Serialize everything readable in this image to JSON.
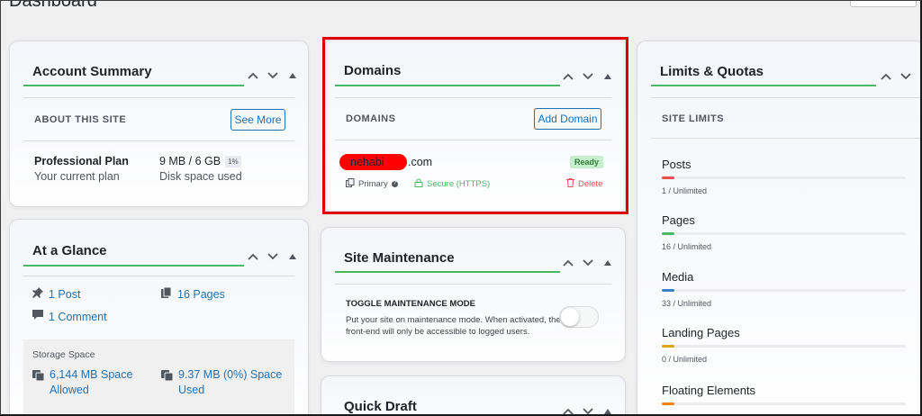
{
  "page": {
    "title": "Dashboard"
  },
  "account_summary": {
    "title": "Account Summary",
    "section": "ABOUT THIS SITE",
    "see_more": "See More",
    "plan_name": "Professional Plan",
    "plan_sub": "Your current plan",
    "disk_value": "9 MB / 6 GB",
    "disk_badge": "1%",
    "disk_sub": "Disk space used"
  },
  "at_a_glance": {
    "title": "At a Glance",
    "posts": "1 Post",
    "pages": "16 Pages",
    "comments": "1 Comment",
    "storage_label": "Storage Space",
    "space_allowed_1": "6,144 MB Space",
    "space_allowed_2": "Allowed",
    "space_used_1": "9.37 MB (0%) Space",
    "space_used_2": "Used"
  },
  "domains": {
    "title": "Domains",
    "section": "DOMAINS",
    "add_button": "Add Domain",
    "domain_prefix": "nehabi",
    "domain_suffix": ".com",
    "status": "Ready",
    "primary": "Primary",
    "secure": "Secure (HTTPS)",
    "delete": "Delete"
  },
  "site_maintenance": {
    "title": "Site Maintenance",
    "section": "TOGGLE MAINTENANCE MODE",
    "description_1": "Put your site on maintenance mode. When activated, the",
    "description_2": "front-end will only be accessible to logged users.",
    "toggle_on": false
  },
  "quick_draft": {
    "title": "Quick Draft"
  },
  "limits": {
    "title": "Limits & Quotas",
    "section": "SITE LIMITS",
    "items": [
      {
        "label": "Posts",
        "value": "1 / Unlimited",
        "color": "#e65054"
      },
      {
        "label": "Pages",
        "value": "16 / Unlimited",
        "color": "#4ab866"
      },
      {
        "label": "Media",
        "value": "33 / Unlimited",
        "color": "#3582c4"
      },
      {
        "label": "Landing Pages",
        "value": "0 / Unlimited",
        "color": "#dba617"
      },
      {
        "label": "Floating Elements",
        "value": "",
        "color": "#f0821e"
      }
    ]
  },
  "colors": {
    "accent": "#2271b1",
    "green": "#4ab866",
    "highlight": "#e00000",
    "redact": "#ff0000"
  }
}
